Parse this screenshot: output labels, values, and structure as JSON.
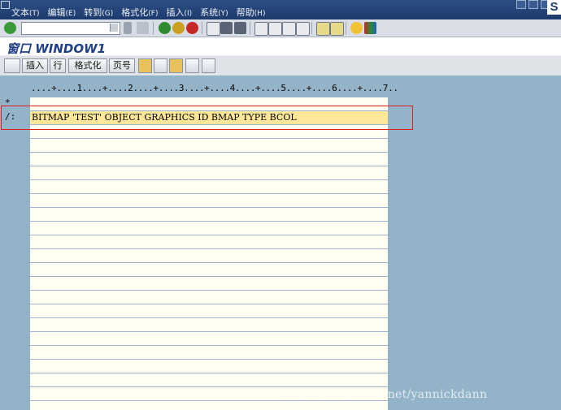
{
  "menubar": {
    "items": [
      {
        "label": "文本",
        "acc": "(T)"
      },
      {
        "label": "编辑",
        "acc": "(E)"
      },
      {
        "label": "转到",
        "acc": "(G)"
      },
      {
        "label": "格式化",
        "acc": "(F)"
      },
      {
        "label": "插入",
        "acc": "(I)"
      },
      {
        "label": "系统",
        "acc": "(Y)"
      },
      {
        "label": "帮助",
        "acc": "(H)"
      }
    ],
    "logo": "S"
  },
  "window": {
    "title": "窗口 WINDOW1"
  },
  "toolbar2": {
    "insert": "插入",
    "line": "行",
    "format": "格式化",
    "page": "页号"
  },
  "editor": {
    "ruler": "....+....1....+....2....+....3....+....4....+....5....+....6....+....7..",
    "format_star": "*",
    "format_cmd": "/:",
    "command_line": "BITMAP 'TEST' OBJECT GRAPHICS ID BMAP TYPE BCOL"
  },
  "watermark": "https://blog.csdn.net/yannickdann",
  "colors": {
    "menubar": "#1d3a6c",
    "highlight_line": "#ffe79a",
    "editor_bg": "#fffef0",
    "red_box": "#e31b1b",
    "background": "#93b3c9"
  }
}
